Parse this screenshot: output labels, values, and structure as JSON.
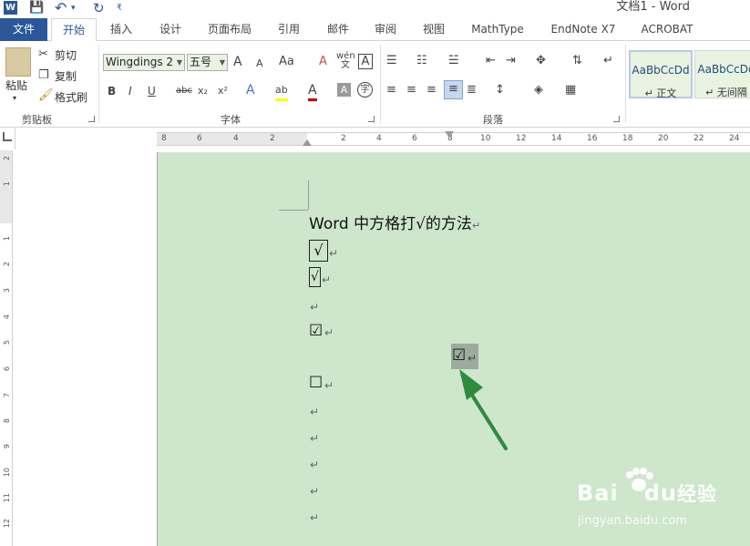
{
  "window": {
    "title": "文档1 - Word",
    "app_icon": "W",
    "qat": {
      "save_icon": "💾",
      "undo_icon": "↶",
      "undo_dropdown": "▾",
      "redo_icon": "↻",
      "customize_icon": "₹"
    }
  },
  "tabs": [
    "文件",
    "开始",
    "插入",
    "设计",
    "页面布局",
    "引用",
    "邮件",
    "审阅",
    "视图",
    "MathType",
    "EndNote X7",
    "ACROBAT"
  ],
  "ribbon": {
    "clipboard": {
      "paste": "粘贴",
      "paste_dd": "▾",
      "cut": "剪切",
      "copy": "复制",
      "format_painter": "格式刷",
      "label": "剪贴板"
    },
    "font": {
      "font_name": "Wingdings 2",
      "font_size": "五号",
      "grow": "A",
      "shrink": "A",
      "change_case": "Aa",
      "clear": "A",
      "phonetic": "wén 文",
      "char_border": "A",
      "bold": "B",
      "italic": "I",
      "underline": "U",
      "strike": "abc",
      "subscript": "x₂",
      "superscript": "x²",
      "text_effects": "A",
      "highlight": "ab",
      "font_color": "A",
      "char_shading": "A",
      "enclose": "字",
      "label": "字体"
    },
    "paragraph": {
      "label": "段落"
    },
    "styles": {
      "normal_preview": "AaBbCcDd",
      "normal_name": "↵ 正文",
      "nospacing_preview": "AaBbCcDd",
      "nospacing_name": "↵ 无间隔"
    }
  },
  "ruler": {
    "h_numbers": [
      "8",
      "6",
      "4",
      "2",
      "2",
      "4",
      "6",
      "8",
      "10",
      "12",
      "14",
      "16",
      "18",
      "20",
      "22",
      "24"
    ],
    "v_numbers": [
      "2",
      "1",
      "1",
      "2",
      "3",
      "4",
      "5",
      "6",
      "7",
      "8",
      "9",
      "10",
      "11",
      "12"
    ]
  },
  "document": {
    "heading": "Word 中方格打√的方法",
    "para_mark": "↵",
    "lines": [
      {
        "glyph": "√",
        "style": "boxed"
      },
      {
        "glyph": "√",
        "style": "boxed-narrow"
      },
      {
        "glyph": "",
        "style": "empty"
      },
      {
        "glyph": "☑",
        "style": "plain"
      },
      {
        "glyph": "☑",
        "style": "highlighted"
      },
      {
        "glyph": "☐",
        "style": "plain"
      },
      {
        "glyph": "",
        "style": "empty"
      },
      {
        "glyph": "",
        "style": "empty"
      },
      {
        "glyph": "",
        "style": "empty"
      },
      {
        "glyph": "",
        "style": "empty"
      },
      {
        "glyph": "",
        "style": "empty"
      }
    ]
  },
  "watermark": {
    "brand": "Bai",
    "brand_rest": "du",
    "brand_cn": "经验",
    "url": "jingyan.baidu.com"
  },
  "colors": {
    "accent": "#2b579a",
    "page": "#cde6cc",
    "arrow": "#2e8b3e"
  }
}
